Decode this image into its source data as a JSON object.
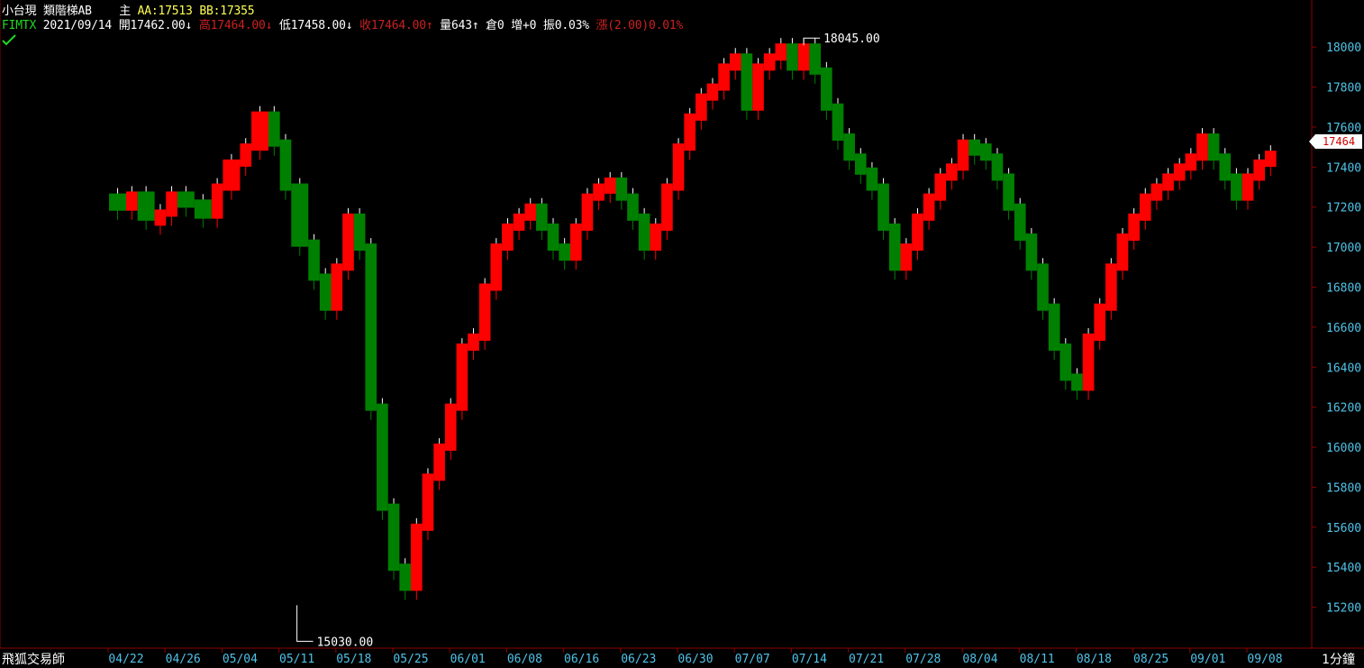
{
  "header": {
    "symbol": "小台現",
    "chart_type_label": "類階梯AB",
    "main_label": "主",
    "aa": "AA:17513",
    "bb": "BB:17355",
    "ticker": "FIMTX",
    "date": "2021/09/14",
    "open": "開17462.00",
    "open_arrow": "↓",
    "high": "高17464.00",
    "high_arrow": "↓",
    "low": "低17458.00",
    "low_arrow": "↓",
    "close": "收17464.00",
    "close_arrow": "↑",
    "volume": "量643",
    "volume_arrow": "↑",
    "oi": "倉0",
    "oi_change": "增+0",
    "amplitude": "振0.03%",
    "change": "漲(2.00)0.01%"
  },
  "footer": {
    "app_name": "飛狐交易師",
    "interval": "1分鐘"
  },
  "current_price_tag": "17464",
  "colors": {
    "up": "#ff0000",
    "down": "#008000",
    "grid_axis": "#8b0000",
    "axis_text": "#4fc3e8",
    "background": "#000000"
  },
  "chart_data": {
    "type": "candlestick-step",
    "x_ticks": [
      "04/22",
      "04/26",
      "05/04",
      "05/11",
      "05/18",
      "05/25",
      "06/01",
      "06/08",
      "06/16",
      "06/23",
      "06/30",
      "07/07",
      "07/14",
      "07/21",
      "07/28",
      "08/04",
      "08/11",
      "08/18",
      "08/25",
      "09/01",
      "09/08"
    ],
    "y_ticks": [
      15200,
      15400,
      15600,
      15800,
      16000,
      16200,
      16400,
      16600,
      16800,
      17000,
      17200,
      17400,
      17600,
      17800,
      18000
    ],
    "ylim": [
      15000,
      18100
    ],
    "annotations": [
      {
        "label": "18045.00",
        "date_index": 12.2,
        "value": 18045
      },
      {
        "label": "15030.00",
        "date_index": 3.3,
        "value": 15030
      }
    ],
    "series_price": [
      [
        0,
        17250
      ],
      [
        0.3,
        17200
      ],
      [
        0.5,
        17260
      ],
      [
        0.8,
        17150
      ],
      [
        1.0,
        17170
      ],
      [
        1.2,
        17260
      ],
      [
        1.5,
        17220
      ],
      [
        1.8,
        17160
      ],
      [
        2.0,
        17300
      ],
      [
        2.3,
        17420
      ],
      [
        2.5,
        17500
      ],
      [
        2.8,
        17660
      ],
      [
        3.0,
        17520
      ],
      [
        3.2,
        17300
      ],
      [
        3.5,
        17020
      ],
      [
        3.7,
        16850
      ],
      [
        3.9,
        16700
      ],
      [
        4.1,
        16900
      ],
      [
        4.3,
        17150
      ],
      [
        4.5,
        17000
      ],
      [
        4.7,
        16200
      ],
      [
        4.9,
        15700
      ],
      [
        5.1,
        15400
      ],
      [
        5.3,
        15300
      ],
      [
        5.5,
        15600
      ],
      [
        5.7,
        15850
      ],
      [
        5.9,
        16000
      ],
      [
        6.1,
        16200
      ],
      [
        6.3,
        16500
      ],
      [
        6.5,
        16550
      ],
      [
        6.7,
        16800
      ],
      [
        6.9,
        17000
      ],
      [
        7.1,
        17100
      ],
      [
        7.3,
        17150
      ],
      [
        7.5,
        17200
      ],
      [
        7.7,
        17100
      ],
      [
        7.9,
        17000
      ],
      [
        8.1,
        16950
      ],
      [
        8.3,
        17100
      ],
      [
        8.5,
        17250
      ],
      [
        8.7,
        17300
      ],
      [
        8.9,
        17330
      ],
      [
        9.1,
        17250
      ],
      [
        9.3,
        17150
      ],
      [
        9.5,
        17000
      ],
      [
        9.7,
        17100
      ],
      [
        9.9,
        17300
      ],
      [
        10.1,
        17500
      ],
      [
        10.3,
        17650
      ],
      [
        10.5,
        17750
      ],
      [
        10.7,
        17800
      ],
      [
        10.9,
        17900
      ],
      [
        11.1,
        17950
      ],
      [
        11.3,
        17700
      ],
      [
        11.5,
        17900
      ],
      [
        11.7,
        17950
      ],
      [
        11.9,
        18000
      ],
      [
        12.1,
        17900
      ],
      [
        12.3,
        18000
      ],
      [
        12.5,
        17880
      ],
      [
        12.7,
        17700
      ],
      [
        12.9,
        17550
      ],
      [
        13.1,
        17450
      ],
      [
        13.3,
        17380
      ],
      [
        13.5,
        17300
      ],
      [
        13.7,
        17100
      ],
      [
        13.9,
        16900
      ],
      [
        14.1,
        17000
      ],
      [
        14.3,
        17150
      ],
      [
        14.5,
        17250
      ],
      [
        14.7,
        17350
      ],
      [
        14.9,
        17400
      ],
      [
        15.1,
        17520
      ],
      [
        15.3,
        17500
      ],
      [
        15.5,
        17450
      ],
      [
        15.7,
        17350
      ],
      [
        15.9,
        17200
      ],
      [
        16.1,
        17050
      ],
      [
        16.3,
        16900
      ],
      [
        16.5,
        16700
      ],
      [
        16.7,
        16500
      ],
      [
        16.9,
        16350
      ],
      [
        17.1,
        16300
      ],
      [
        17.3,
        16550
      ],
      [
        17.5,
        16700
      ],
      [
        17.7,
        16900
      ],
      [
        17.9,
        17050
      ],
      [
        18.1,
        17150
      ],
      [
        18.3,
        17250
      ],
      [
        18.5,
        17300
      ],
      [
        18.7,
        17350
      ],
      [
        18.9,
        17400
      ],
      [
        19.1,
        17450
      ],
      [
        19.3,
        17550
      ],
      [
        19.5,
        17450
      ],
      [
        19.7,
        17350
      ],
      [
        19.9,
        17250
      ],
      [
        20.1,
        17350
      ],
      [
        20.3,
        17420
      ],
      [
        20.5,
        17464
      ]
    ]
  }
}
